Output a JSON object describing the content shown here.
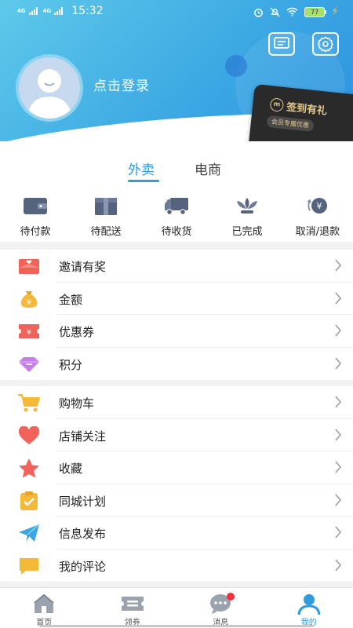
{
  "status_bar": {
    "network1": "4G",
    "network2": "4G",
    "time": "15:32",
    "battery": "77"
  },
  "profile": {
    "login_text": "点击登录"
  },
  "vip_card": {
    "title": "签到有礼",
    "subtitle": "会员专属优惠"
  },
  "orders": {
    "tabs": [
      {
        "label": "外卖",
        "active": true
      },
      {
        "label": "电商",
        "active": false
      }
    ],
    "items": [
      {
        "label": "待付款",
        "icon": "wallet-icon"
      },
      {
        "label": "待配送",
        "icon": "package-icon"
      },
      {
        "label": "待收货",
        "icon": "truck-icon"
      },
      {
        "label": "已完成",
        "icon": "lotus-icon"
      },
      {
        "label": "取消/退款",
        "icon": "refund-icon"
      }
    ]
  },
  "menu_group1": [
    {
      "label": "邀请有奖",
      "icon": "gift-envelope-icon"
    },
    {
      "label": "金额",
      "icon": "money-bag-icon"
    },
    {
      "label": "优惠券",
      "icon": "coupon-icon"
    },
    {
      "label": "积分",
      "icon": "diamond-icon"
    }
  ],
  "menu_group2": [
    {
      "label": "购物车",
      "icon": "cart-icon"
    },
    {
      "label": "店铺关注",
      "icon": "heart-icon"
    },
    {
      "label": "收藏",
      "icon": "star-icon"
    },
    {
      "label": "同城计划",
      "icon": "clipboard-check-icon"
    },
    {
      "label": "信息发布",
      "icon": "paper-plane-icon"
    },
    {
      "label": "我的评论",
      "icon": "comment-icon"
    }
  ],
  "bottom_nav": [
    {
      "label": "首页",
      "icon": "home-icon",
      "active": false
    },
    {
      "label": "领券",
      "icon": "ticket-icon",
      "active": false
    },
    {
      "label": "消息",
      "icon": "chat-icon",
      "active": false,
      "badge": true
    },
    {
      "label": "我的",
      "icon": "user-icon",
      "active": true
    }
  ],
  "colors": {
    "accent": "#2f9be0",
    "header_start": "#5ec9ea",
    "header_end": "#2d90de",
    "badge": "#f0313c"
  }
}
